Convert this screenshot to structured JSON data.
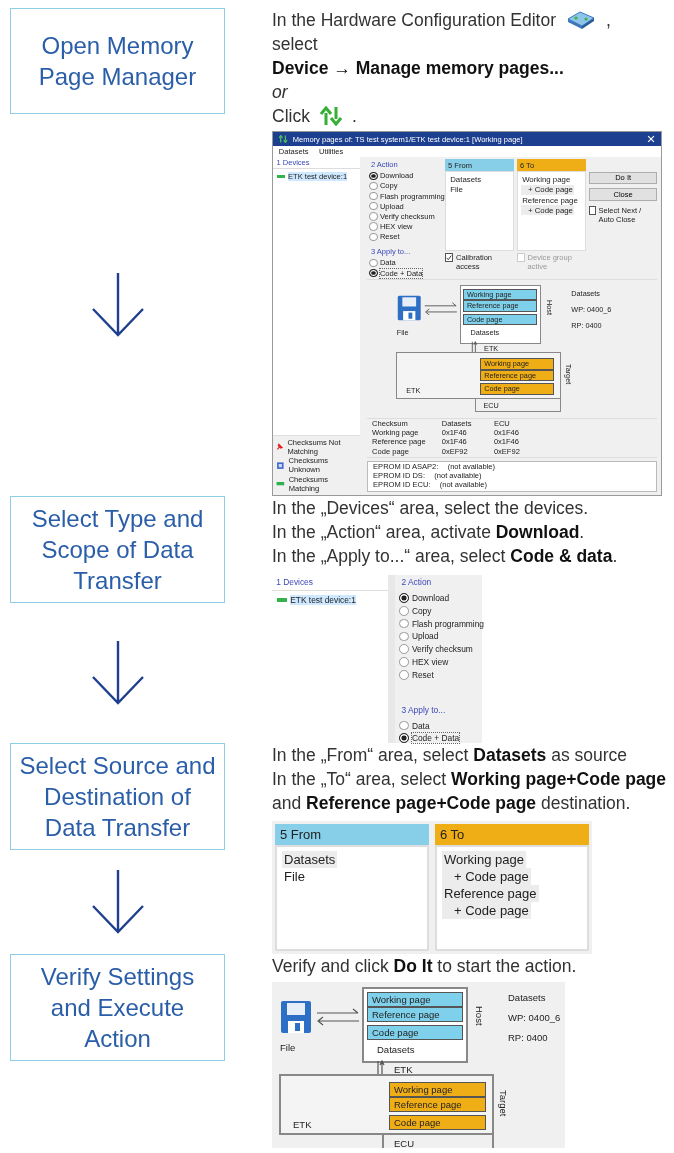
{
  "steps": [
    {
      "title": "Open Memory Page Manager",
      "lines": [
        [
          {
            "kind": "text",
            "text": "In the Hardware Configuration Editor"
          },
          {
            "kind": "config-icon"
          },
          {
            "kind": "text",
            "text": ","
          }
        ],
        [
          {
            "kind": "text",
            "text": "select"
          }
        ],
        [
          {
            "kind": "bold",
            "text": "Device → Manage memory pages..."
          }
        ],
        [
          {
            "kind": "italic",
            "text": "or"
          }
        ],
        [
          {
            "kind": "text",
            "text": "Click"
          },
          {
            "kind": "updown-icon"
          },
          {
            "kind": "text",
            "text": "."
          }
        ]
      ],
      "figure": {
        "kind": "dialog",
        "title": "Memory pages of: TS test system1/ETK test device:1 [Working page]",
        "menu": [
          "Datasets",
          "Utilities"
        ],
        "devices": {
          "heading": "1 Devices",
          "items": [
            {
              "label": "ETK test device:1",
              "selected": true
            }
          ]
        },
        "action": {
          "heading": "2 Action",
          "options": [
            {
              "label": "Download",
              "selected": true
            },
            {
              "label": "Copy",
              "selected": false
            },
            {
              "label": "Flash programming",
              "selected": false
            },
            {
              "label": "Upload",
              "selected": false
            },
            {
              "label": "Verify checksum",
              "selected": false
            },
            {
              "label": "HEX view",
              "selected": false
            },
            {
              "label": "Reset",
              "selected": false
            }
          ]
        },
        "apply_to": {
          "heading": "3 Apply to...",
          "options": [
            {
              "label": "Data",
              "selected": false
            },
            {
              "label": "Code + Data",
              "selected": true
            }
          ]
        },
        "from": {
          "heading": "5 From",
          "items": [
            {
              "label": "Datasets",
              "selected": false
            },
            {
              "label": "File",
              "selected": false
            }
          ]
        },
        "to": {
          "heading": "6 To",
          "items": [
            {
              "label": "Working page",
              "selected": false,
              "children": [
                {
                  "label": "+ Code page",
                  "selected": true
                }
              ]
            },
            {
              "label": "Reference page",
              "selected": false,
              "children": [
                {
                  "label": "+ Code page",
                  "selected": true
                }
              ]
            }
          ]
        },
        "calibration_access": {
          "label": "Calibration access",
          "checked": true,
          "disabled": false
        },
        "device_group_active": {
          "label": "Device group active",
          "checked": false,
          "disabled": true
        },
        "buttons": [
          "Do It",
          "Close"
        ],
        "auto_close": {
          "label": "Select Next / Auto Close",
          "checked": false,
          "disabled": false
        },
        "diagram": {
          "file_label": "File",
          "host_label": "Host",
          "host_pages": [
            "Working page",
            "Reference page",
            "Code page"
          ],
          "host_source": "Datasets",
          "link_label": "ETK",
          "target_label": "Target",
          "target_pages": [
            "Working page",
            "Reference page",
            "Code page"
          ],
          "etk_label": "ETK",
          "ecu_label": "ECU",
          "info": [
            "Datasets",
            "WP: 0400_6",
            "RP: 0400"
          ]
        },
        "checksums": {
          "columns": [
            "Checksum",
            "Datasets",
            "ECU"
          ],
          "rows": [
            [
              "Working page",
              "0x1F46",
              "0x1F46"
            ],
            [
              "Reference page",
              "0x1F46",
              "0x1F46"
            ],
            [
              "Code page",
              "0xEF92",
              "0xEF92"
            ]
          ]
        },
        "legend": [
          {
            "kind": "not-matching",
            "label": "Checksums Not Matching"
          },
          {
            "kind": "unknown",
            "label": "Checksums Unknown"
          },
          {
            "kind": "matching",
            "label": "Checksums Matching"
          }
        ],
        "eprom": [
          {
            "label": "EPROM ID ASAP2:",
            "value": "(not available)"
          },
          {
            "label": "EPROM ID DS:",
            "value": "(not available)"
          },
          {
            "label": "EPROM ID ECU:",
            "value": "(not available)"
          }
        ]
      }
    },
    {
      "title": "Select Type and Scope of Data Transfer",
      "lines": [
        [
          {
            "kind": "text",
            "text": "In the „Devices“ area, select the devices."
          }
        ],
        [
          {
            "kind": "text",
            "text": "In the „Action“ area, activate **Download**."
          }
        ],
        [
          {
            "kind": "text",
            "text": "In the „Apply to...“ area, select **Code & data**."
          }
        ]
      ],
      "figure": {
        "kind": "selection",
        "devices": {
          "heading": "1 Devices",
          "items": [
            {
              "label": "ETK test device:1",
              "selected": true
            }
          ]
        },
        "action": {
          "heading": "2 Action",
          "options": [
            {
              "label": "Download",
              "selected": true
            },
            {
              "label": "Copy",
              "selected": false
            },
            {
              "label": "Flash programming",
              "selected": false
            },
            {
              "label": "Upload",
              "selected": false
            },
            {
              "label": "Verify checksum",
              "selected": false
            },
            {
              "label": "HEX view",
              "selected": false
            },
            {
              "label": "Reset",
              "selected": false
            }
          ]
        },
        "apply_to": {
          "heading": "3 Apply to...",
          "options": [
            {
              "label": "Data",
              "selected": false
            },
            {
              "label": "Code + Data",
              "selected": true
            }
          ]
        }
      }
    },
    {
      "title": "Select Source and Destination of Data Transfer",
      "lines": [
        [
          {
            "kind": "text",
            "text": "In the „From“ area, select **Datasets** as source"
          }
        ],
        [
          {
            "kind": "text",
            "text": "In the „To“ area, select **Working page+Code page** and **Reference page+Code page** destination."
          }
        ]
      ],
      "figure": {
        "kind": "source_target",
        "from": {
          "heading": "5 From",
          "items": [
            {
              "label": "Datasets",
              "selected": true
            },
            {
              "label": "File",
              "selected": false
            }
          ]
        },
        "to": {
          "heading": "6 To",
          "items": [
            {
              "label": "Working page",
              "selected": true,
              "children": [
                {
                  "label": "+ Code page",
                  "selected": true
                }
              ]
            },
            {
              "label": "Reference page",
              "selected": true,
              "children": [
                {
                  "label": "+ Code page",
                  "selected": true
                }
              ]
            }
          ]
        }
      }
    },
    {
      "title": "Verify Settings and Execute Action",
      "lines": [
        [
          {
            "kind": "text",
            "text": "Verify and click **Do It** to start the action."
          }
        ]
      ],
      "figure": {
        "kind": "diagram",
        "diagram": {
          "file_label": "File",
          "host_label": "Host",
          "host_pages": [
            "Working page",
            "Reference page",
            "Code page"
          ],
          "host_source": "Datasets",
          "link_label": "ETK",
          "target_label": "Target",
          "target_pages": [
            "Working page",
            "Reference page",
            "Code page"
          ],
          "etk_label": "ETK",
          "ecu_label": "ECU",
          "info": [
            "Datasets",
            "WP: 0400_6",
            "RP: 0400"
          ]
        }
      }
    }
  ]
}
